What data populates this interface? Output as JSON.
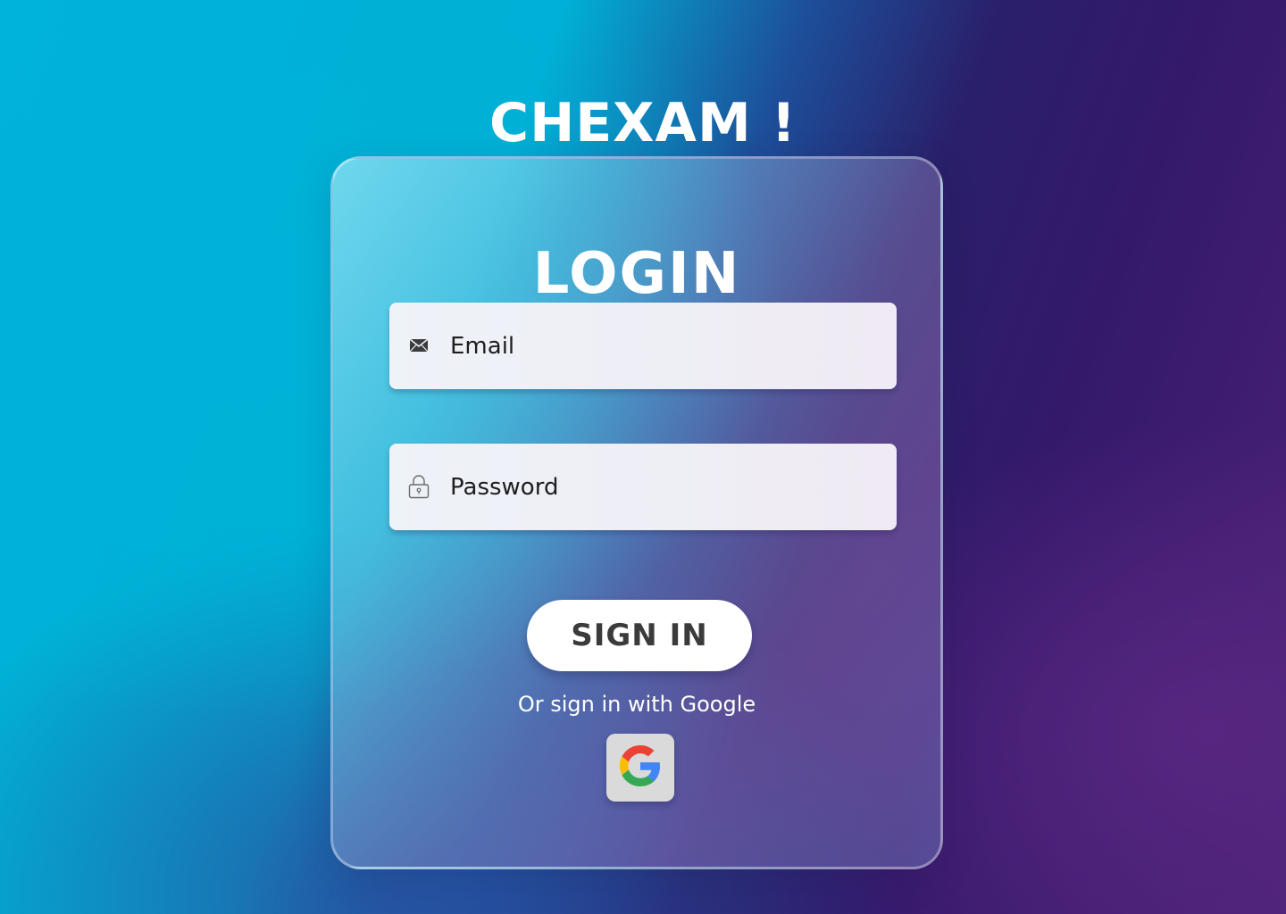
{
  "brand": {
    "title": "CHEXAM !"
  },
  "login_card": {
    "title": "LOGIN",
    "email": {
      "icon": "envelope-icon",
      "placeholder": "Email",
      "value": ""
    },
    "password": {
      "icon": "lock-icon",
      "placeholder": "Password",
      "value": ""
    },
    "signin_label": "SIGN IN",
    "alt_signin_text": "Or sign in with Google",
    "google_button": {
      "icon": "google-icon"
    }
  },
  "colors": {
    "text_primary": "#ffffff",
    "button_bg": "#ffffff",
    "button_text": "#3b3b3b",
    "google_button_bg": "#dadada",
    "google_blue": "#4285F4",
    "google_red": "#EA4335",
    "google_yellow": "#FBBC05",
    "google_green": "#34A853"
  }
}
